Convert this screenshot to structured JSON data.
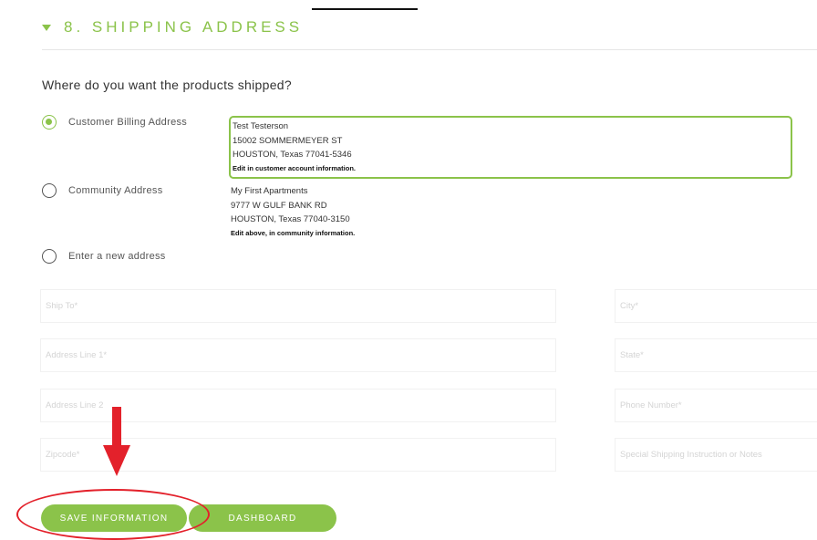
{
  "header": {
    "title": "8. SHIPPING ADDRESS"
  },
  "question": "Where do you want the products shipped?",
  "options": [
    {
      "label": "Customer Billing Address",
      "selected": true
    },
    {
      "label": "Community Address",
      "selected": false
    },
    {
      "label": "Enter a new address",
      "selected": false
    }
  ],
  "billing_address": {
    "name": "Test Testerson",
    "street": "15002 SOMMERMEYER ST",
    "city_line": "HOUSTON, Texas 77041-5346",
    "note": "Edit in customer account information."
  },
  "community_address": {
    "name": "My First Apartments",
    "street": "9777 W GULF BANK RD",
    "city_line": "HOUSTON, Texas 77040-3150",
    "note": "Edit above, in community information."
  },
  "fields": {
    "ship_to": "Ship To*",
    "address1": "Address Line 1*",
    "address2": "Address Line 2",
    "zipcode": "Zipcode*",
    "city": "City*",
    "state": "State*",
    "phone": "Phone Number*",
    "notes": "Special Shipping Instruction or Notes"
  },
  "buttons": {
    "save": "SAVE INFORMATION",
    "dashboard": "DASHBOARD"
  },
  "colors": {
    "accent": "#8bc34a",
    "annotation": "#e3212b"
  }
}
